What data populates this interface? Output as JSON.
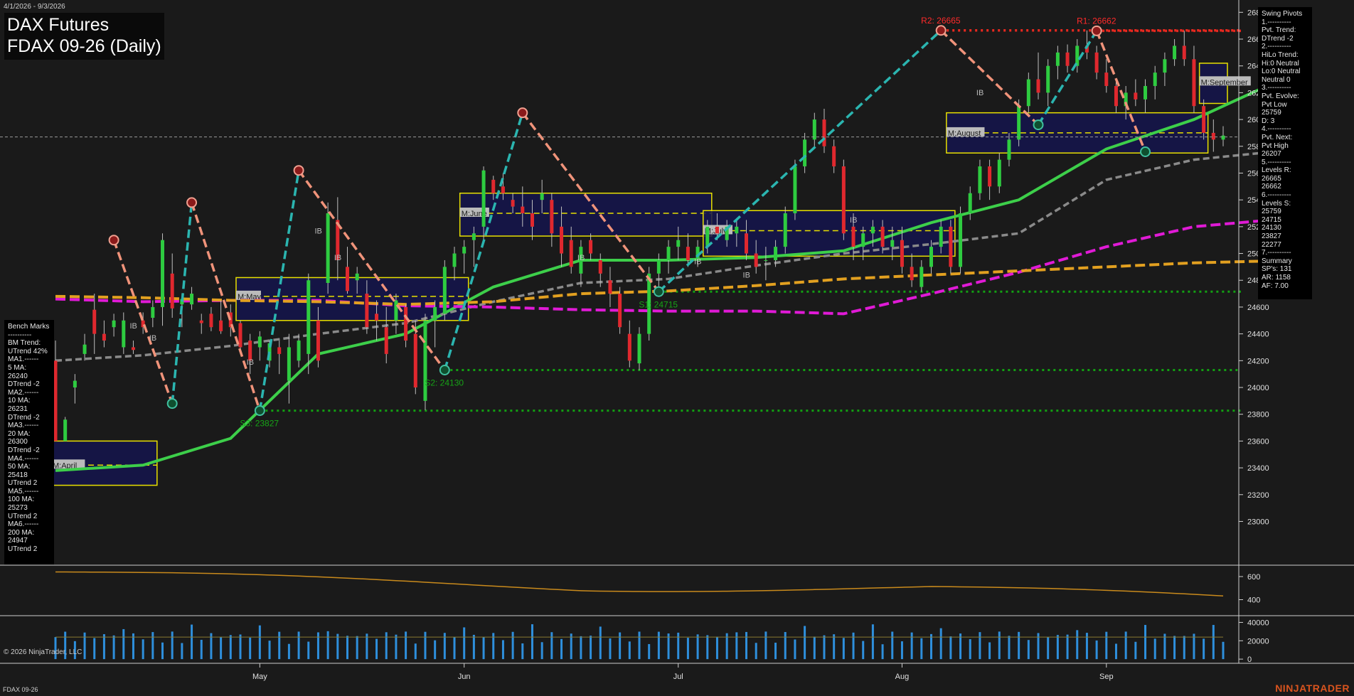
{
  "header": {
    "date_range": "4/1/2026 - 9/3/2026",
    "title_line1": "DAX Futures",
    "title_line2": "FDAX 09-26 (Daily)"
  },
  "footer": {
    "instrument": "FDAX 09-26",
    "copyright": "© 2026 NinjaTrader, LLC",
    "brand": "NINJATRADER"
  },
  "colors": {
    "background": "#1a1a1a",
    "up_candle": "#2ecc40",
    "down_candle": "#e0282e",
    "ma_green": "#3dcf4a",
    "ma_gray": "#8a8a8a",
    "ma_magenta": "#e01ad6",
    "ma_orange": "#e2a020",
    "swing_up": "#2bb5b0",
    "swing_down": "#f0937a",
    "resistance": "#e8281f",
    "support": "#12a012",
    "value_box_fill": "#15154e",
    "value_box_border": "#e8e000",
    "volume": "#2e8fdc"
  },
  "benchmarks": {
    "text": "Bench Marks\n----------\nBM Trend:\nUTrend 42%\nMA1.------\n5 MA:\n26240\nDTrend -2\nMA2.------\n10 MA:\n26231\nDTrend -2\nMA3.------\n20 MA:\n26300\nDTrend -2\nMA4.------\n50 MA:\n25418\nUTrend 2\nMA5.------\n100 MA:\n25273\nUTrend 2\nMA6.------\n200 MA:\n24947\nUTrend 2"
  },
  "swing_panel": {
    "text": "Swing Pivots\n1.----------\nPvt. Trend:\nDTrend -2\n2.----------\nHiLo Trend:\nHi:0 Neutral\nLo:0 Neutral\nNeutral 0\n3.----------\nPvt. Evolve:\nPvt Low\n25759\nD: 3\n4.----------\nPvt. Next:\nPvt High\n26207\n5.----------\nLevels R:\n26665\n26662\n6.----------\nLevels S:\n25759\n24715\n24130\n23827\n22277\n7.----------\nSummary\nSP's: 131\nAR: 1158\nAF: 7.00"
  },
  "chart_data": {
    "type": "candlestick",
    "title": "FDAX 09-26 (Daily)",
    "xlabel": "",
    "ylabel": "",
    "x_month_labels": [
      {
        "label": "May",
        "date": "2026-05-01"
      },
      {
        "label": "Jun",
        "date": "2026-06-01"
      },
      {
        "label": "Jul",
        "date": "2026-07-01"
      },
      {
        "label": "Aug",
        "date": "2026-08-03"
      },
      {
        "label": "Sep",
        "date": "2026-09-01"
      }
    ],
    "ylim": [
      22700,
      26860
    ],
    "y_ticks": [
      23000,
      23200,
      23400,
      23600,
      23800,
      24000,
      24200,
      24400,
      24600,
      24800,
      25000,
      25200,
      25400,
      25600,
      25800,
      26000,
      26200,
      26400,
      26600,
      26800
    ],
    "last_price_line": 25870,
    "ohlc_sessions_apr1_to_sep3": [
      [
        24200,
        24350,
        23650,
        23600
      ],
      [
        23600,
        23780,
        23700,
        23760
      ],
      [
        24000,
        24100,
        23880,
        24050
      ],
      [
        24250,
        24400,
        24200,
        24320
      ],
      [
        24580,
        24700,
        24250,
        24400
      ],
      [
        24400,
        24500,
        24300,
        24350
      ],
      [
        24450,
        24550,
        24380,
        24500
      ],
      [
        24300,
        24560,
        24250,
        24500
      ],
      [
        24300,
        24350,
        24250,
        24280
      ],
      [
        24500,
        24560,
        24400,
        24450
      ],
      [
        24520,
        24650,
        24450,
        24600
      ],
      [
        24600,
        25150,
        24460,
        25100
      ],
      [
        24850,
        25000,
        24520,
        24590
      ],
      [
        24620,
        24700,
        24450,
        24660
      ],
      [
        24620,
        24750,
        24580,
        24700
      ],
      [
        24500,
        24550,
        24400,
        24480
      ],
      [
        24550,
        24600,
        24420,
        24450
      ],
      [
        24500,
        24650,
        24400,
        24420
      ],
      [
        24560,
        24620,
        24380,
        24450
      ],
      [
        24480,
        24500,
        24280,
        24300
      ],
      [
        24350,
        24400,
        24100,
        24200
      ],
      [
        24300,
        24420,
        24200,
        24380
      ],
      [
        24200,
        24350,
        24150,
        24330
      ],
      [
        24300,
        24350,
        24100,
        24250
      ],
      [
        24050,
        24400,
        23880,
        24300
      ],
      [
        24200,
        24400,
        24150,
        24350
      ],
      [
        24250,
        24850,
        24100,
        24800
      ],
      [
        24500,
        24600,
        24150,
        24200
      ],
      [
        24780,
        25380,
        24700,
        25300
      ],
      [
        25250,
        25420,
        24800,
        24950
      ],
      [
        24900,
        25050,
        24700,
        24720
      ],
      [
        24800,
        24900,
        24700,
        24850
      ],
      [
        24700,
        24800,
        24400,
        24450
      ],
      [
        24550,
        24650,
        24350,
        24500
      ],
      [
        24450,
        24600,
        24180,
        24250
      ],
      [
        24500,
        24700,
        24400,
        24650
      ],
      [
        24600,
        24620,
        24300,
        24350
      ],
      [
        24400,
        24500,
        23950,
        24000
      ],
      [
        23900,
        24550,
        23830,
        24500
      ],
      [
        24500,
        24650,
        24300,
        24600
      ],
      [
        24550,
        24950,
        24500,
        24900
      ],
      [
        24900,
        25050,
        24800,
        25000
      ],
      [
        25000,
        25100,
        24850,
        25050
      ],
      [
        25100,
        25200,
        24900,
        25150
      ],
      [
        25200,
        25650,
        25100,
        25620
      ],
      [
        25550,
        25580,
        25400,
        25450
      ],
      [
        25500,
        25600,
        25400,
        25450
      ],
      [
        25400,
        25450,
        25300,
        25350
      ],
      [
        25350,
        25500,
        25200,
        25300
      ],
      [
        25300,
        25400,
        25100,
        25200
      ],
      [
        25400,
        25550,
        25300,
        25450
      ],
      [
        25400,
        25450,
        25050,
        25150
      ],
      [
        25200,
        25350,
        24900,
        25000
      ],
      [
        25100,
        25200,
        24850,
        24900
      ],
      [
        24850,
        25100,
        24750,
        25050
      ],
      [
        25100,
        25150,
        24950,
        25000
      ],
      [
        24950,
        25000,
        24750,
        24850
      ],
      [
        24800,
        24900,
        24600,
        24700
      ],
      [
        24700,
        24750,
        24400,
        24450
      ],
      [
        24400,
        24500,
        24150,
        24200
      ],
      [
        24180,
        24450,
        24130,
        24400
      ],
      [
        24400,
        24900,
        24350,
        24850
      ],
      [
        24850,
        25000,
        24700,
        24950
      ],
      [
        24950,
        25100,
        24850,
        25050
      ],
      [
        25050,
        25200,
        24950,
        25100
      ],
      [
        25050,
        25150,
        24900,
        24950
      ],
      [
        24950,
        25100,
        24900,
        25050
      ],
      [
        25050,
        25250,
        25000,
        25200
      ],
      [
        25200,
        25300,
        25100,
        25150
      ],
      [
        25100,
        25250,
        25050,
        25200
      ],
      [
        25150,
        25250,
        25050,
        25200
      ],
      [
        25150,
        25250,
        24950,
        25000
      ],
      [
        25000,
        25100,
        24850,
        24900
      ],
      [
        24950,
        25050,
        24800,
        24950
      ],
      [
        24950,
        25100,
        24900,
        25050
      ],
      [
        25050,
        25350,
        25000,
        25300
      ],
      [
        25300,
        25700,
        25250,
        25650
      ],
      [
        25650,
        25900,
        25600,
        25850
      ],
      [
        25850,
        26050,
        25800,
        26000
      ],
      [
        26000,
        26080,
        25750,
        25800
      ],
      [
        25800,
        25850,
        25600,
        25650
      ],
      [
        25650,
        25700,
        25100,
        25150
      ],
      [
        25200,
        25300,
        24950,
        25050
      ],
      [
        25050,
        25200,
        24950,
        25150
      ],
      [
        25150,
        25250,
        25050,
        25200
      ],
      [
        25200,
        25250,
        25000,
        25050
      ],
      [
        25050,
        25200,
        24950,
        25100
      ],
      [
        25100,
        25200,
        24850,
        24900
      ],
      [
        24900,
        25000,
        24750,
        24800
      ],
      [
        24750,
        24950,
        24715,
        24900
      ],
      [
        24900,
        25100,
        24850,
        25050
      ],
      [
        25050,
        25250,
        25000,
        25200
      ],
      [
        25200,
        25250,
        24850,
        24900
      ],
      [
        24900,
        25350,
        24850,
        25300
      ],
      [
        25300,
        25500,
        25250,
        25450
      ],
      [
        25450,
        25700,
        25400,
        25650
      ],
      [
        25650,
        25700,
        25400,
        25500
      ],
      [
        25500,
        25750,
        25450,
        25700
      ],
      [
        25700,
        25900,
        25650,
        25850
      ],
      [
        25850,
        26150,
        25800,
        26100
      ],
      [
        26100,
        26350,
        26050,
        26300
      ],
      [
        26300,
        26500,
        26150,
        26200
      ],
      [
        26200,
        26450,
        26100,
        26400
      ],
      [
        26400,
        26550,
        26300,
        26500
      ],
      [
        26500,
        26560,
        26350,
        26400
      ],
      [
        26400,
        26600,
        26350,
        26550
      ],
      [
        26550,
        26665,
        26450,
        26500
      ],
      [
        26500,
        26550,
        26300,
        26350
      ],
      [
        26350,
        26450,
        26200,
        26250
      ],
      [
        26250,
        26300,
        26050,
        26100
      ],
      [
        26100,
        26250,
        26000,
        26200
      ],
      [
        26200,
        26300,
        26100,
        26150
      ],
      [
        26150,
        26300,
        26050,
        26250
      ],
      [
        26250,
        26400,
        26150,
        26350
      ],
      [
        26350,
        26500,
        26250,
        26450
      ],
      [
        26450,
        26600,
        26400,
        26550
      ],
      [
        26550,
        26662,
        26400,
        26450
      ],
      [
        26450,
        26550,
        26050,
        26100
      ],
      [
        26100,
        26150,
        25850,
        25900
      ],
      [
        25900,
        26000,
        25759,
        25850
      ],
      [
        25850,
        25950,
        25800,
        25880
      ]
    ],
    "moving_averages": [
      {
        "name": "20 MA",
        "color": "#3dcf4a",
        "points": [
          [
            0,
            23380
          ],
          [
            9,
            23420
          ],
          [
            18,
            23620
          ],
          [
            27,
            24250
          ],
          [
            36,
            24400
          ],
          [
            45,
            24750
          ],
          [
            54,
            24950
          ],
          [
            63,
            24950
          ],
          [
            72,
            24970
          ],
          [
            81,
            25020
          ],
          [
            90,
            25230
          ],
          [
            99,
            25400
          ],
          [
            108,
            25780
          ],
          [
            117,
            26000
          ],
          [
            126,
            26300
          ],
          [
            128,
            26240
          ]
        ]
      },
      {
        "name": "50 MA",
        "color": "#8a8a8a",
        "points": [
          [
            0,
            24200
          ],
          [
            9,
            24240
          ],
          [
            18,
            24310
          ],
          [
            27,
            24400
          ],
          [
            36,
            24480
          ],
          [
            45,
            24640
          ],
          [
            54,
            24780
          ],
          [
            63,
            24810
          ],
          [
            72,
            24910
          ],
          [
            81,
            25000
          ],
          [
            90,
            25070
          ],
          [
            99,
            25150
          ],
          [
            108,
            25550
          ],
          [
            117,
            25700
          ],
          [
            128,
            25780
          ]
        ]
      },
      {
        "name": "100 MA",
        "color": "#e01ad6",
        "points": [
          [
            0,
            24660
          ],
          [
            9,
            24640
          ],
          [
            18,
            24650
          ],
          [
            27,
            24650
          ],
          [
            36,
            24610
          ],
          [
            45,
            24600
          ],
          [
            54,
            24580
          ],
          [
            63,
            24570
          ],
          [
            72,
            24570
          ],
          [
            81,
            24550
          ],
          [
            90,
            24700
          ],
          [
            99,
            24860
          ],
          [
            108,
            25050
          ],
          [
            117,
            25200
          ],
          [
            128,
            25270
          ]
        ]
      },
      {
        "name": "200 MA",
        "color": "#e2a020",
        "points": [
          [
            0,
            24680
          ],
          [
            9,
            24670
          ],
          [
            18,
            24650
          ],
          [
            27,
            24640
          ],
          [
            36,
            24620
          ],
          [
            45,
            24640
          ],
          [
            54,
            24700
          ],
          [
            63,
            24720
          ],
          [
            72,
            24760
          ],
          [
            81,
            24810
          ],
          [
            90,
            24840
          ],
          [
            99,
            24870
          ],
          [
            108,
            24900
          ],
          [
            117,
            24930
          ],
          [
            128,
            24950
          ]
        ]
      }
    ],
    "swing_points": [
      {
        "session": 6,
        "price": 25100,
        "kind": "high"
      },
      {
        "session": 12,
        "price": 23880,
        "kind": "low"
      },
      {
        "session": 14,
        "price": 25380,
        "kind": "high"
      },
      {
        "session": 21,
        "price": 23827,
        "kind": "low"
      },
      {
        "session": 25,
        "price": 25620,
        "kind": "high"
      },
      {
        "session": 40,
        "price": 24130,
        "kind": "low"
      },
      {
        "session": 48,
        "price": 26050,
        "kind": "high"
      },
      {
        "session": 62,
        "price": 24715,
        "kind": "low"
      },
      {
        "session": 91,
        "price": 26665,
        "kind": "high"
      },
      {
        "session": 101,
        "price": 25960,
        "kind": "low"
      },
      {
        "session": 107,
        "price": 26662,
        "kind": "high"
      },
      {
        "session": 112,
        "price": 25759,
        "kind": "low"
      }
    ],
    "levels": [
      {
        "label": "R2: 26665",
        "price": 26665,
        "type": "resistance"
      },
      {
        "label": "R1: 26662",
        "price": 26662,
        "type": "resistance"
      },
      {
        "label": "S1: 24715",
        "price": 24715,
        "type": "support"
      },
      {
        "label": "S2: 24130",
        "price": 24130,
        "type": "support"
      },
      {
        "label": "S3: 23827",
        "price": 23827,
        "type": "support"
      }
    ],
    "value_areas": [
      {
        "label": "M:April",
        "top": 23600,
        "bottom": 23270,
        "vpoc": 23420
      },
      {
        "label": "M:May",
        "top": 24820,
        "bottom": 24500,
        "vpoc": 24680
      },
      {
        "label": "M:June",
        "top": 25450,
        "bottom": 25130,
        "vpoc": 25300
      },
      {
        "label": "M:July",
        "top": 25320,
        "bottom": 24980,
        "vpoc": 25170
      },
      {
        "label": "M:August",
        "top": 26050,
        "bottom": 25750,
        "vpoc": 25900
      },
      {
        "label": "M:September",
        "top": 26420,
        "bottom": 26120,
        "vpoc": 26280
      }
    ],
    "ib_labels": [
      "IB",
      "IB",
      "IB",
      "IB",
      "IB",
      "IB",
      "IB",
      "IB",
      "IB",
      "IB"
    ],
    "indicator1": {
      "y_ticks": [
        400,
        600
      ],
      "ylim": [
        280,
        680
      ]
    },
    "indicator2": {
      "y_ticks": [
        0,
        20000,
        40000
      ],
      "ylim": [
        -3000,
        45000
      ],
      "avg_volume": 24000
    }
  }
}
